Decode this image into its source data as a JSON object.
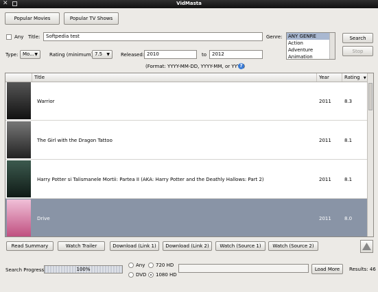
{
  "window": {
    "title": "VidMasta"
  },
  "top_buttons": {
    "popular_movies": "Popular Movies",
    "popular_tv": "Popular TV Shows"
  },
  "search": {
    "any_label": "Any",
    "title_label": "Title:",
    "title_value": "Softpedia test",
    "genre_label": "Genre:",
    "genres": [
      "ANY GENRE",
      "Action",
      "Adventure",
      "Animation"
    ],
    "search_button": "Search",
    "stop_button": "Stop",
    "type_label": "Type:",
    "type_value": "Mo...",
    "rating_label": "Rating (minimum):",
    "rating_value": "7.5",
    "released_label": "Released:",
    "released_from": "2010",
    "to_label": "to",
    "released_to": "2012",
    "format_hint": "(Format: YYYY-MM-DD, YYYY-MM, or YYYY)",
    "help_icon": "?"
  },
  "table": {
    "headers": {
      "title": "Title",
      "year": "Year",
      "rating": "Rating"
    },
    "sort_indicator": "▼",
    "rows": [
      {
        "title": "Warrior",
        "year": "2011",
        "rating": "8.3",
        "poster_color": "#2a2a2a"
      },
      {
        "title": "The Girl with the Dragon Tattoo",
        "year": "2011",
        "rating": "8.1",
        "poster_color": "#3a3a3a"
      },
      {
        "title": "Harry Potter si Talismanele Mortii: Partea II (AKA: Harry Potter and the Deathly Hallows: Part 2)",
        "year": "2011",
        "rating": "8.1",
        "poster_color": "#1f2f2a"
      },
      {
        "title": "Drive",
        "year": "2011",
        "rating": "8.0",
        "poster_color": "#d87aa8"
      }
    ]
  },
  "actions": {
    "read_summary": "Read Summary",
    "watch_trailer": "Watch Trailer",
    "download1": "Download (Link 1)",
    "download2": "Download (Link 2)",
    "watch_source1": "Watch (Source 1)",
    "watch_source2": "Watch (Source 2)"
  },
  "status": {
    "progress_label": "Search Progress:",
    "progress_text": "100%",
    "progress_fraction": 1.0,
    "any_label": "Any",
    "hd720_label": "720 HD",
    "dvd_label": "DVD",
    "hd1080_label": "1080 HD",
    "load_more": "Load More",
    "results": "Results: 46"
  }
}
